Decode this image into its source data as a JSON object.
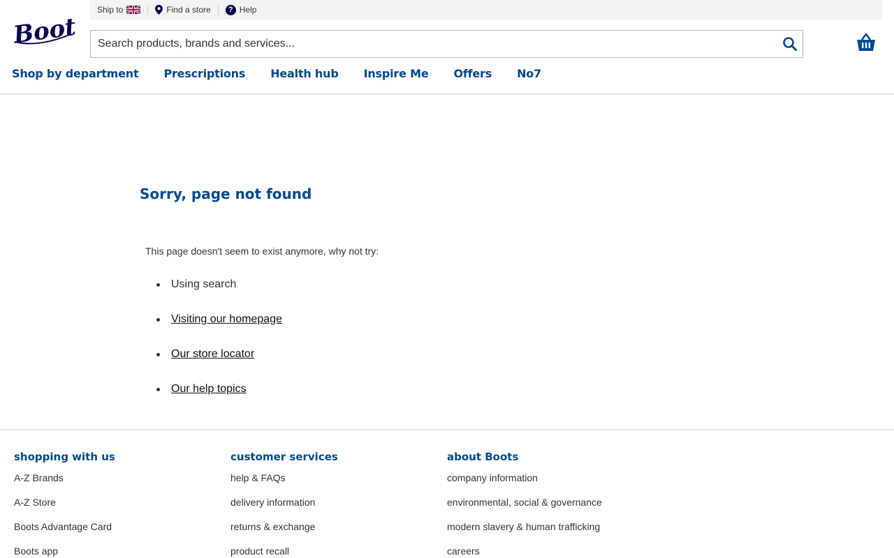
{
  "brand": {
    "logo_text": "Boots",
    "color": "#05054b",
    "accent": "#004990"
  },
  "utility": {
    "ship_to_label": "Ship to",
    "find_store_label": "Find a store",
    "help_label": "Help"
  },
  "search": {
    "placeholder": "Search products, brands and services..."
  },
  "nav": {
    "items": [
      {
        "label": "Shop by department"
      },
      {
        "label": "Prescriptions"
      },
      {
        "label": "Health hub"
      },
      {
        "label": "Inspire Me"
      },
      {
        "label": "Offers"
      },
      {
        "label": "No7"
      }
    ]
  },
  "main": {
    "title": "Sorry, page not found",
    "intro": "This page doesn't seem to exist anymore, why not try:",
    "suggestions": [
      {
        "label": "Using search"
      },
      {
        "label": "Visiting our homepage"
      },
      {
        "label": "Our store locator"
      },
      {
        "label": "Our help topics"
      }
    ]
  },
  "footer": {
    "columns": [
      {
        "heading": "shopping with us",
        "links": [
          "A-Z Brands",
          "A-Z Store",
          "Boots Advantage Card",
          "Boots app"
        ]
      },
      {
        "heading": "customer services",
        "links": [
          "help & FAQs",
          "delivery information",
          "returns & exchange",
          "product recall"
        ]
      },
      {
        "heading": "about Boots",
        "links": [
          "company information",
          "environmental, social & governance",
          "modern slavery & human trafficking",
          "careers"
        ]
      }
    ]
  }
}
